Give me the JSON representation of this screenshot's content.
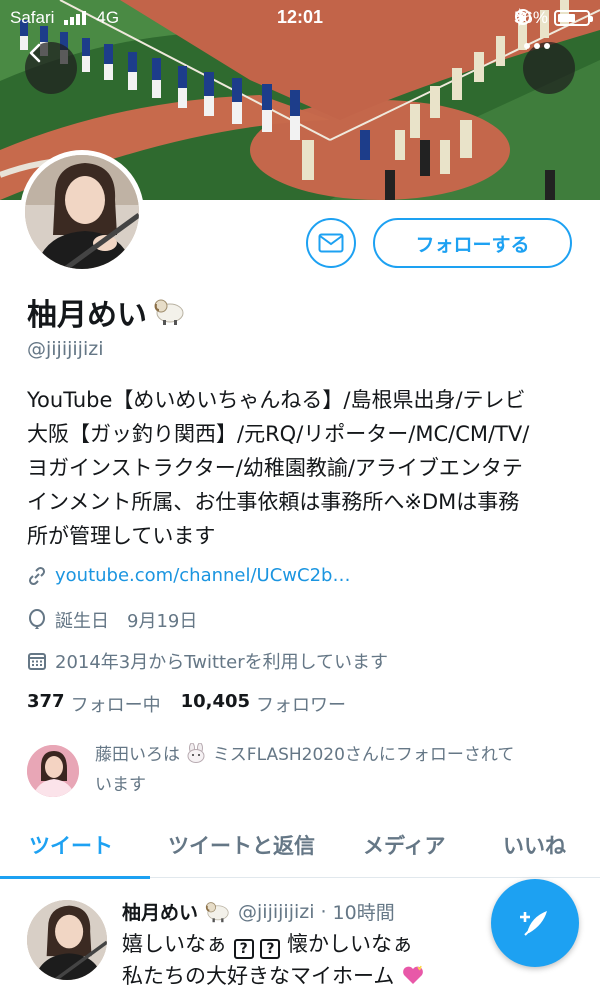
{
  "status_bar": {
    "carrier": "Safari",
    "network": "4G",
    "time": "12:01",
    "battery": "56%"
  },
  "profile": {
    "name": "柚月めい",
    "handle": "@jijijijizi",
    "bio_lines": [
      "YouTube【めいめいちゃんねる】/島根県出身/テレビ",
      "大阪【ガッ釣り関西】/元RQ/リポーター/MC/CM/TV/",
      "ヨガインストラクター/幼稚園教諭/アライブエンタテ",
      "インメント所属、お仕事依頼は事務所へ※DMは事務",
      "所が管理しています"
    ],
    "link": "youtube.com/channel/UCwC2b…",
    "birthday_label": "誕生日",
    "birthday": "9月19日",
    "joined": "2014年3月からTwitterを利用しています",
    "following_count": "377",
    "following_label": "フォロー中",
    "followers_count": "10,405",
    "followers_label": "フォロワー",
    "followed_by_name": "藤田いろは",
    "followed_by_rest": "ミスFLASH2020さんにフォローされて",
    "followed_by_line2": "います"
  },
  "actions": {
    "follow_label": "フォローする"
  },
  "tabs": [
    {
      "label": "ツイート",
      "active": true
    },
    {
      "label": "ツイートと返信",
      "active": false
    },
    {
      "label": "メディア",
      "active": false
    },
    {
      "label": "いいね",
      "active": false
    }
  ],
  "tweet": {
    "name": "柚月めい",
    "handle": "@jijijijizi",
    "separator": "·",
    "time": "10時間",
    "line1_a": "嬉しいなぁ",
    "line1_b": "懐かしいなぁ",
    "line2": "私たちの大好きなマイホーム",
    "box_glyph": "?"
  },
  "colors": {
    "accent": "#1da1f2",
    "link": "#1b95e0",
    "muted": "#657786",
    "text": "#14171a"
  },
  "icons": [
    "back-icon",
    "more-icon",
    "mail-icon",
    "link-icon",
    "balloon-icon",
    "calendar-icon",
    "compose-icon",
    "sheep-emoji",
    "rabbit-emoji",
    "heart-emoji"
  ]
}
